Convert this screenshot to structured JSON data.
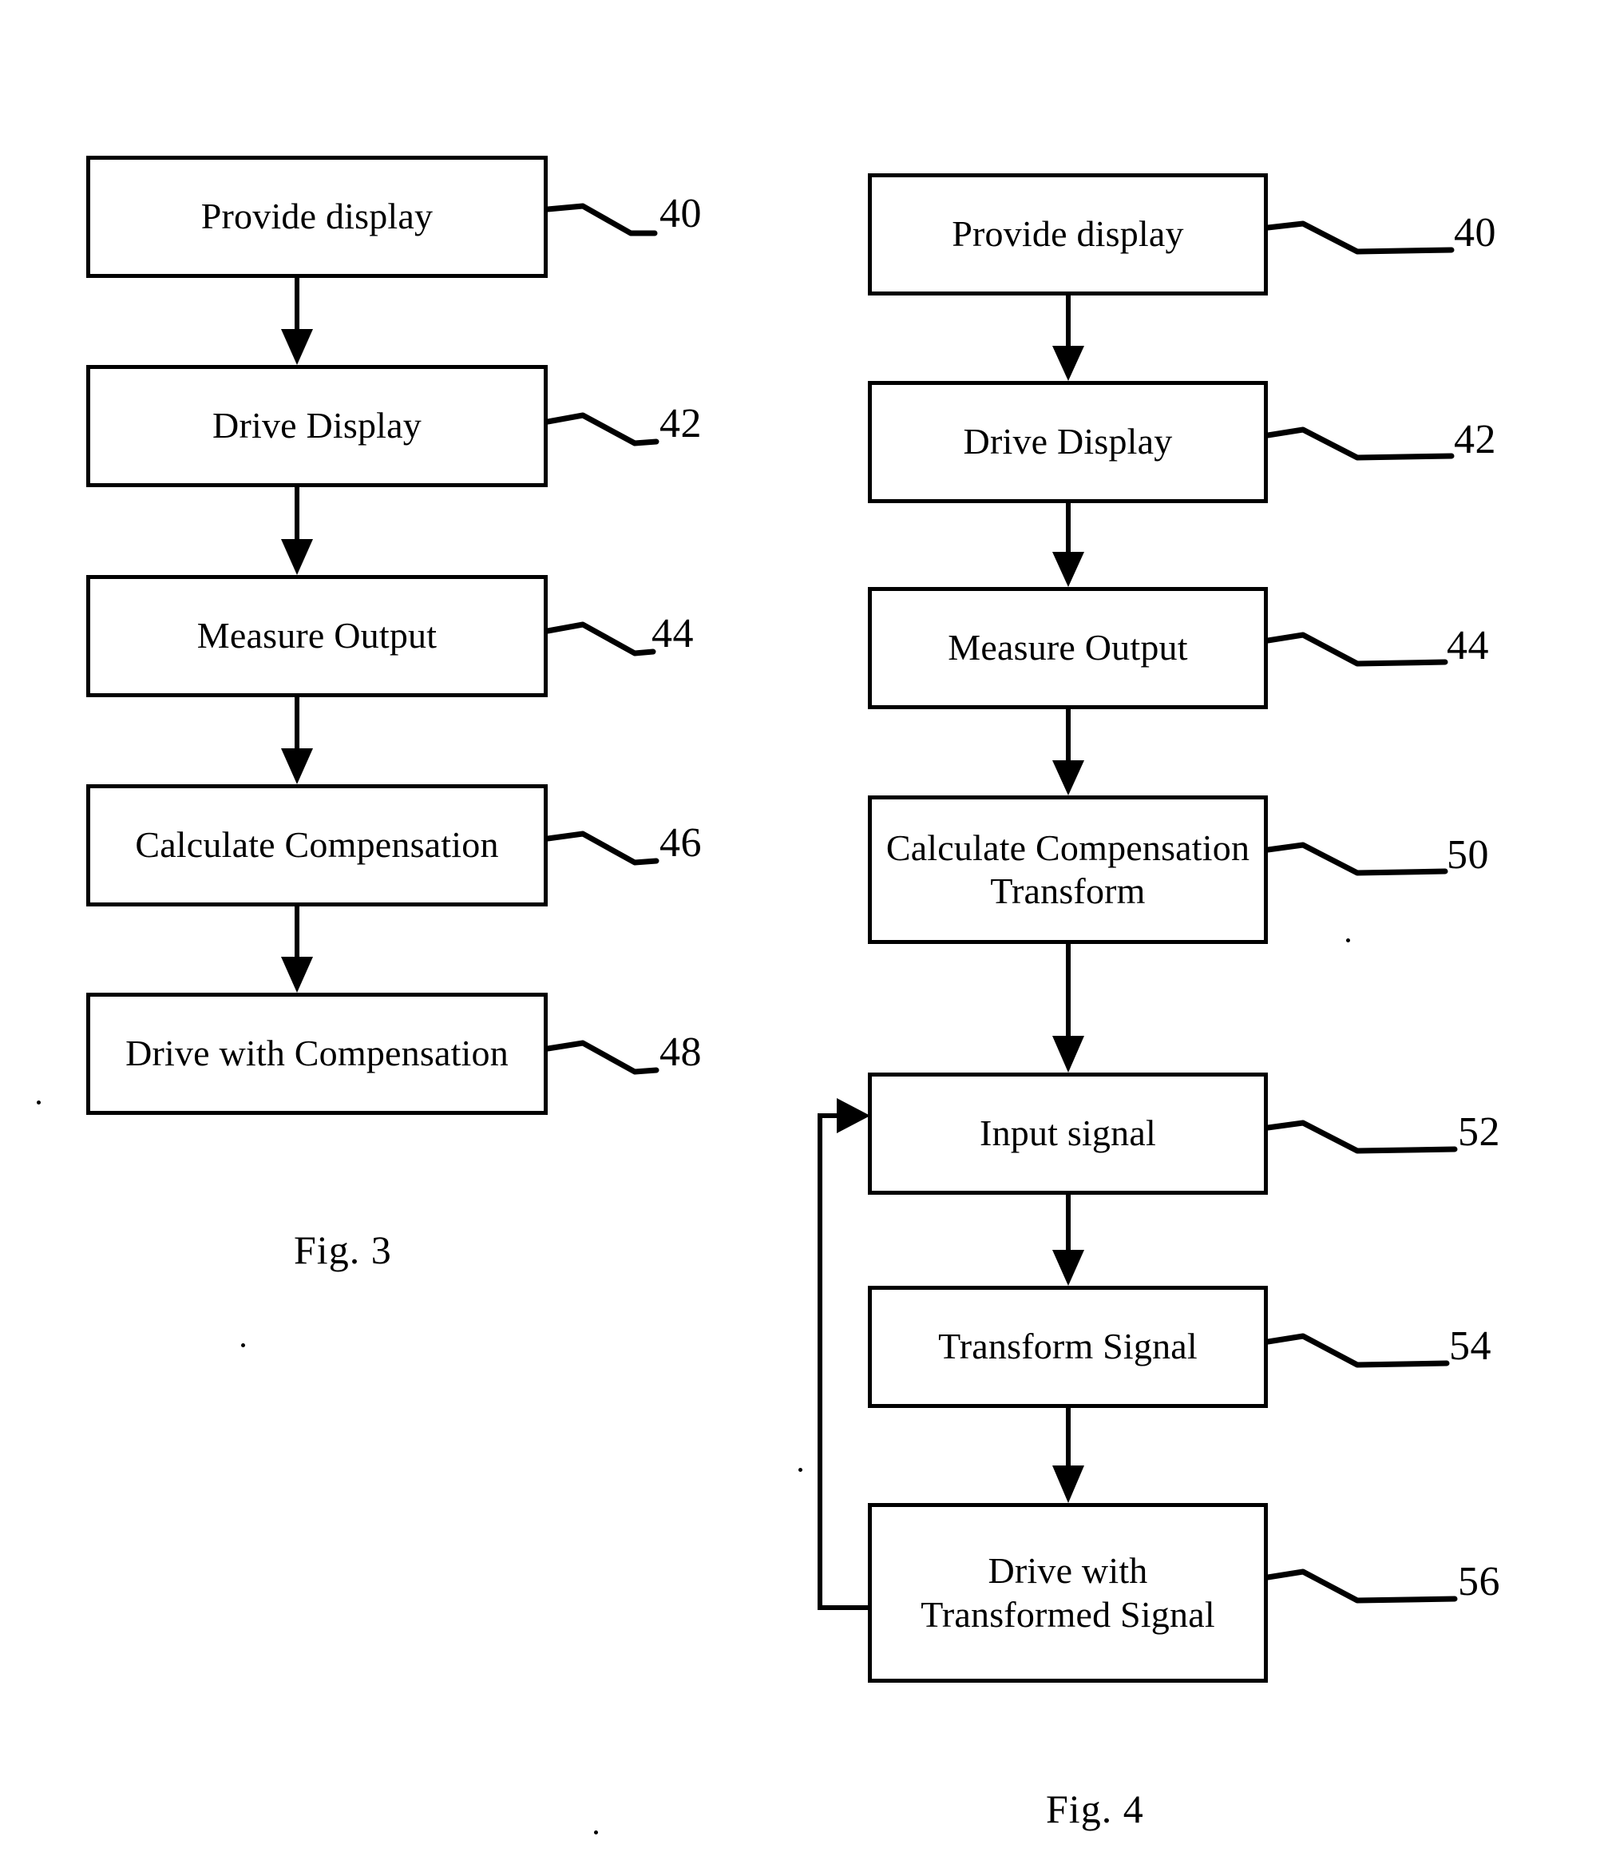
{
  "document": {
    "type": "patent-flowchart-sheet",
    "background_color": "#ffffff",
    "ink_color": "#000000"
  },
  "figures": [
    {
      "id": "fig-3",
      "caption": "Fig. 3",
      "steps": [
        {
          "label": "Provide display",
          "ref": "40"
        },
        {
          "label": "Drive Display",
          "ref": "42"
        },
        {
          "label": "Measure Output",
          "ref": "44"
        },
        {
          "label": "Calculate Compensation",
          "ref": "46"
        },
        {
          "label": "Drive with Compensation",
          "ref": "48"
        }
      ]
    },
    {
      "id": "fig-4",
      "caption": "Fig. 4",
      "steps": [
        {
          "label": "Provide display",
          "ref": "40"
        },
        {
          "label": "Drive Display",
          "ref": "42"
        },
        {
          "label": "Measure Output",
          "ref": "44"
        },
        {
          "label": "Calculate Compensation\nTransform",
          "ref": "50"
        },
        {
          "label": "Input signal",
          "ref": "52"
        },
        {
          "label": "Transform Signal",
          "ref": "54"
        },
        {
          "label": "Drive with\nTransformed Signal",
          "ref": "56"
        }
      ],
      "feedback_loop": {
        "from_step": "Drive with\nTransformed Signal",
        "to_step": "Input signal"
      }
    }
  ]
}
